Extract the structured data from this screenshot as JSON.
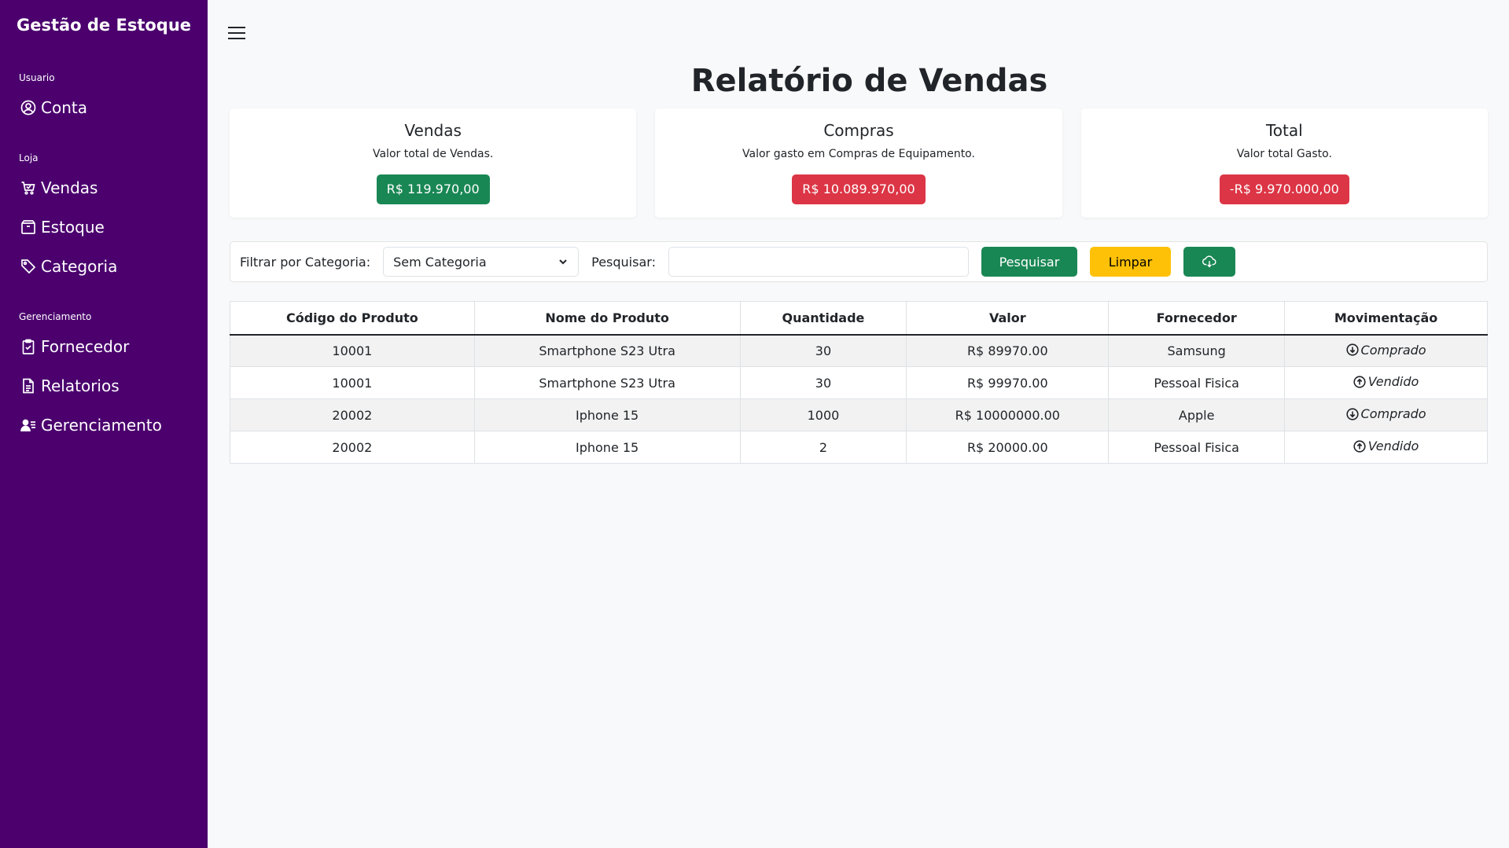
{
  "sidebar": {
    "brand": "Gestão de Estoque",
    "sections": [
      {
        "label": "Usuario",
        "items": [
          {
            "label": "Conta",
            "icon": "user-circle-icon"
          }
        ]
      },
      {
        "label": "Loja",
        "items": [
          {
            "label": "Vendas",
            "icon": "cart-icon"
          },
          {
            "label": "Estoque",
            "icon": "box-icon"
          },
          {
            "label": "Categoria",
            "icon": "tag-icon"
          }
        ]
      },
      {
        "label": "Gerenciamento",
        "items": [
          {
            "label": "Fornecedor",
            "icon": "clipboard-check-icon"
          },
          {
            "label": "Relatorios",
            "icon": "document-icon"
          },
          {
            "label": "Gerenciamento",
            "icon": "user-list-icon"
          }
        ]
      }
    ]
  },
  "header": {
    "title": "Relatório de Vendas"
  },
  "cards": [
    {
      "title": "Vendas",
      "subtitle": "Valor total de Vendas.",
      "value": "R$ 119.970,00",
      "color": "#198754"
    },
    {
      "title": "Compras",
      "subtitle": "Valor gasto em Compras de Equipamento.",
      "value": "R$ 10.089.970,00",
      "color": "#dc3545"
    },
    {
      "title": "Total",
      "subtitle": "Valor total Gasto.",
      "value": "-R$ 9.970.000,00",
      "color": "#dc3545"
    }
  ],
  "filter": {
    "category_label": "Filtrar por Categoria:",
    "category_value": "Sem Categoria",
    "search_label": "Pesquisar:",
    "search_value": "",
    "search_button": "Pesquisar",
    "clear_button": "Limpar",
    "download_icon": "cloud-download-icon"
  },
  "table": {
    "headers": [
      "Código do Produto",
      "Nome do Produto",
      "Quantidade",
      "Valor",
      "Fornecedor",
      "Movimentação"
    ],
    "rows": [
      {
        "code": "10001",
        "name": "Smartphone S23 Utra",
        "qty": "30",
        "value": "R$ 89970.00",
        "supplier": "Samsung",
        "movement": "Comprado",
        "movement_icon": "arrow-down-circle-icon"
      },
      {
        "code": "10001",
        "name": "Smartphone S23 Utra",
        "qty": "30",
        "value": "R$ 99970.00",
        "supplier": "Pessoal Fisica",
        "movement": "Vendido",
        "movement_icon": "arrow-up-circle-icon"
      },
      {
        "code": "20002",
        "name": "Iphone 15",
        "qty": "1000",
        "value": "R$ 10000000.00",
        "supplier": "Apple",
        "movement": "Comprado",
        "movement_icon": "arrow-down-circle-icon"
      },
      {
        "code": "20002",
        "name": "Iphone 15",
        "qty": "2",
        "value": "R$ 20000.00",
        "supplier": "Pessoal Fisica",
        "movement": "Vendido",
        "movement_icon": "arrow-up-circle-icon"
      }
    ]
  },
  "colors": {
    "sidebar": "#4b006e",
    "success": "#198754",
    "danger": "#dc3545",
    "warning": "#ffc107"
  }
}
